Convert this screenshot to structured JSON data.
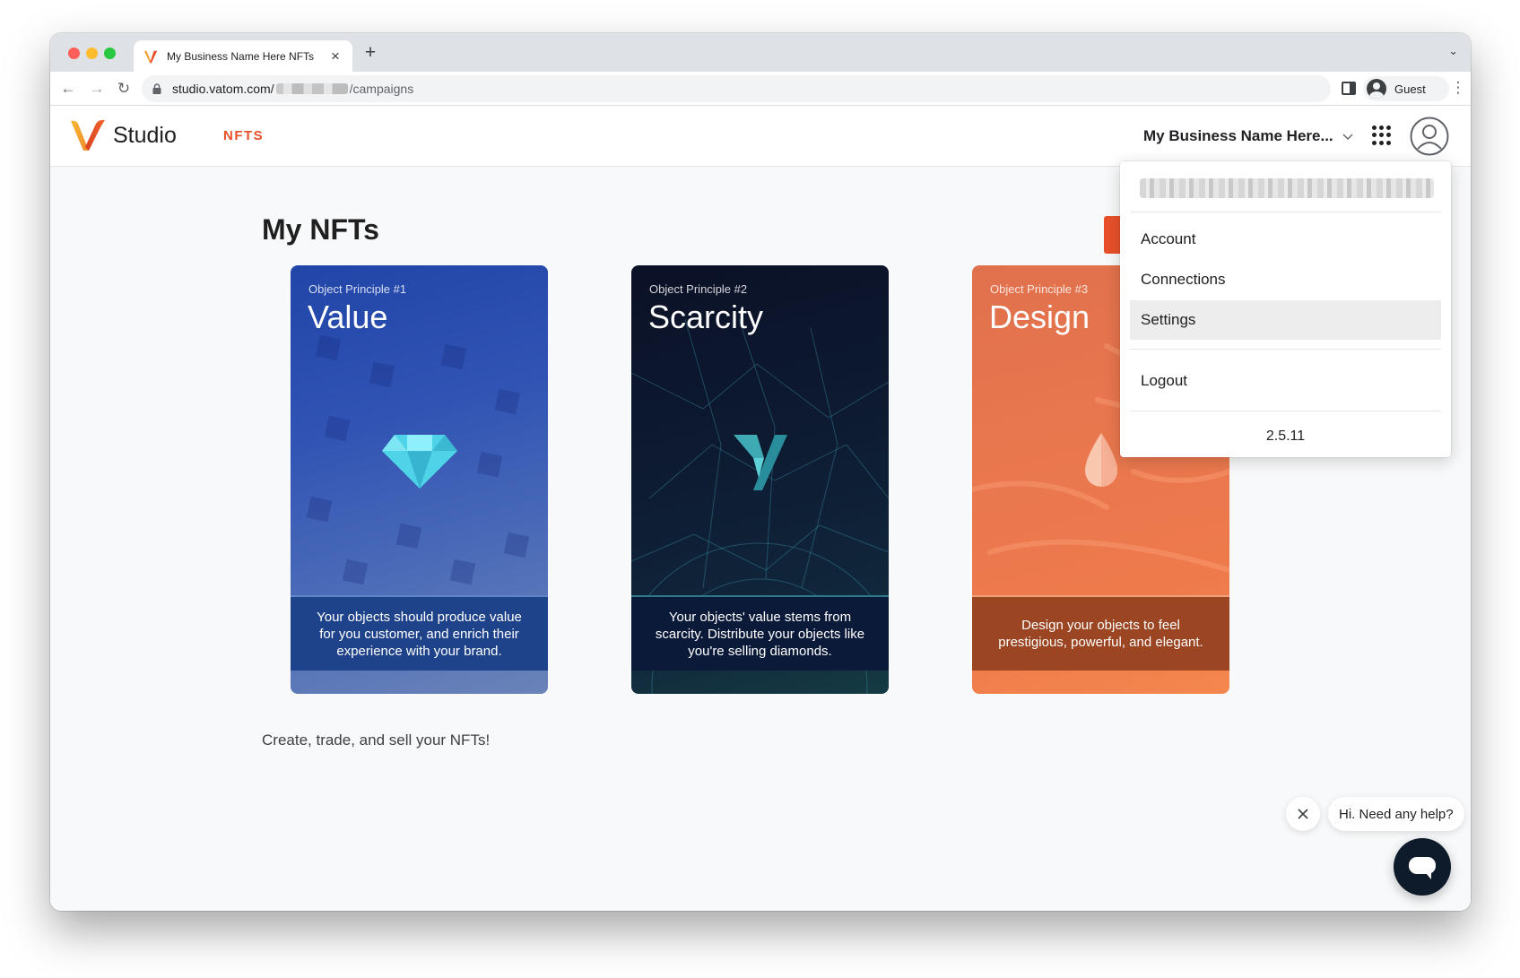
{
  "browser": {
    "tab_title": "My Business Name Here NFTs",
    "url_domain": "studio.vatom.com/",
    "url_path": "/campaigns",
    "profile_name": "Guest"
  },
  "app": {
    "brand_name": "Studio",
    "nav_nfts": "NFTS",
    "business_name": "My Business Name Here...",
    "accent_color": "#e8502a"
  },
  "main": {
    "title": "My NFTs",
    "tagline": "Create, trade, and sell your NFTs!",
    "cards": [
      {
        "eyebrow": "Object Principle #1",
        "title": "Value",
        "caption": "Your objects should produce value for you customer, and enrich their experience with your brand.",
        "icon": "diamond-icon"
      },
      {
        "eyebrow": "Object Principle #2",
        "title": "Scarcity",
        "caption": "Your objects' value stems from scarcity. Distribute your objects like you're selling diamonds.",
        "icon": "vatom-logo-icon"
      },
      {
        "eyebrow": "Object Principle #3",
        "title": "Design",
        "caption": "Design your objects to feel prestigious, powerful, and elegant.",
        "icon": "droplet-icon"
      }
    ]
  },
  "dropdown": {
    "items": [
      "Account",
      "Connections",
      "Settings",
      "Logout"
    ],
    "active_item": "Settings",
    "version": "2.5.11"
  },
  "chat": {
    "greeting": "Hi. Need any help?"
  }
}
